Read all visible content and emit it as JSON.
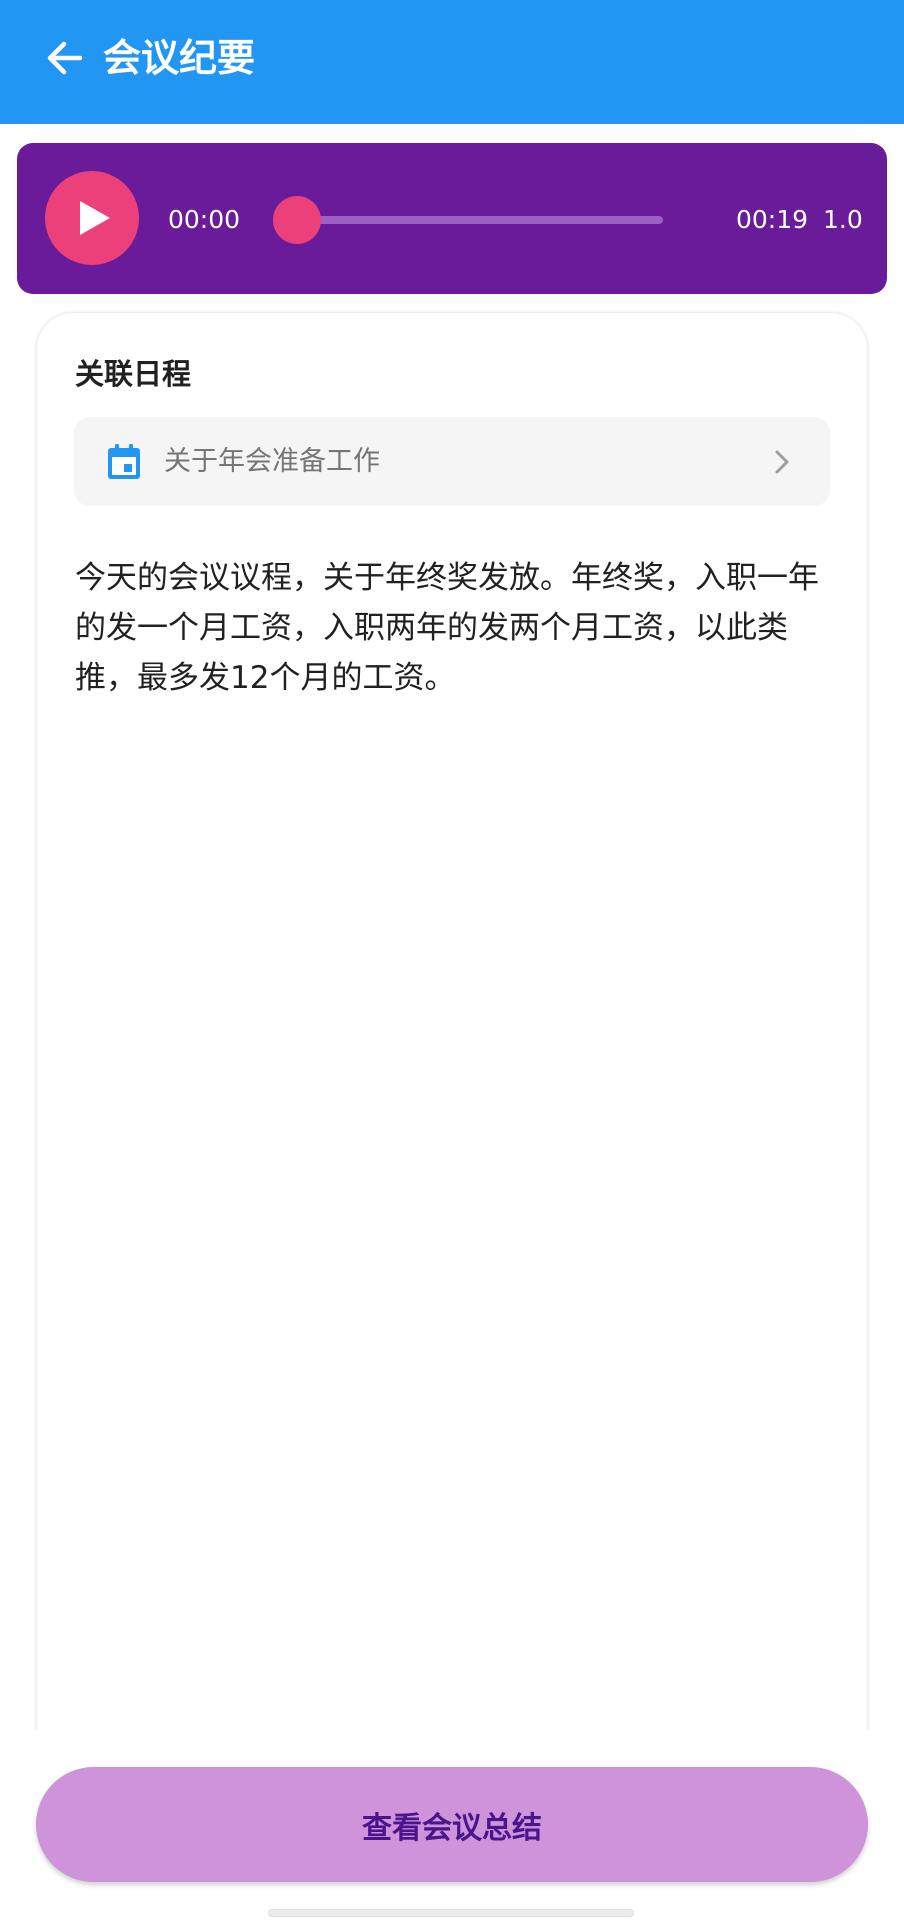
{
  "appbar": {
    "title": "会议纪要",
    "back_icon": "arrow-left-icon",
    "color": "#2196F3"
  },
  "player": {
    "current_time": "00:00",
    "total_time": "00:19",
    "speed": "1.0",
    "progress": 0.0,
    "play_icon": "play-icon",
    "background": "#6A1B9A",
    "accent": "#EC407A"
  },
  "card": {
    "section_title": "关联日程",
    "schedule": {
      "text": "关于年会准备工作",
      "icon": "calendar-icon",
      "chevron": "chevron-right-icon"
    },
    "transcript": "今天的会议议程，关于年终奖发放。年终奖，入职一年的发一个月工资，入职两年的发两个月工资，以此类推，最多发12个月的工资。"
  },
  "footer": {
    "summary_button": "查看会议总结",
    "button_color": "#CE93D8"
  }
}
